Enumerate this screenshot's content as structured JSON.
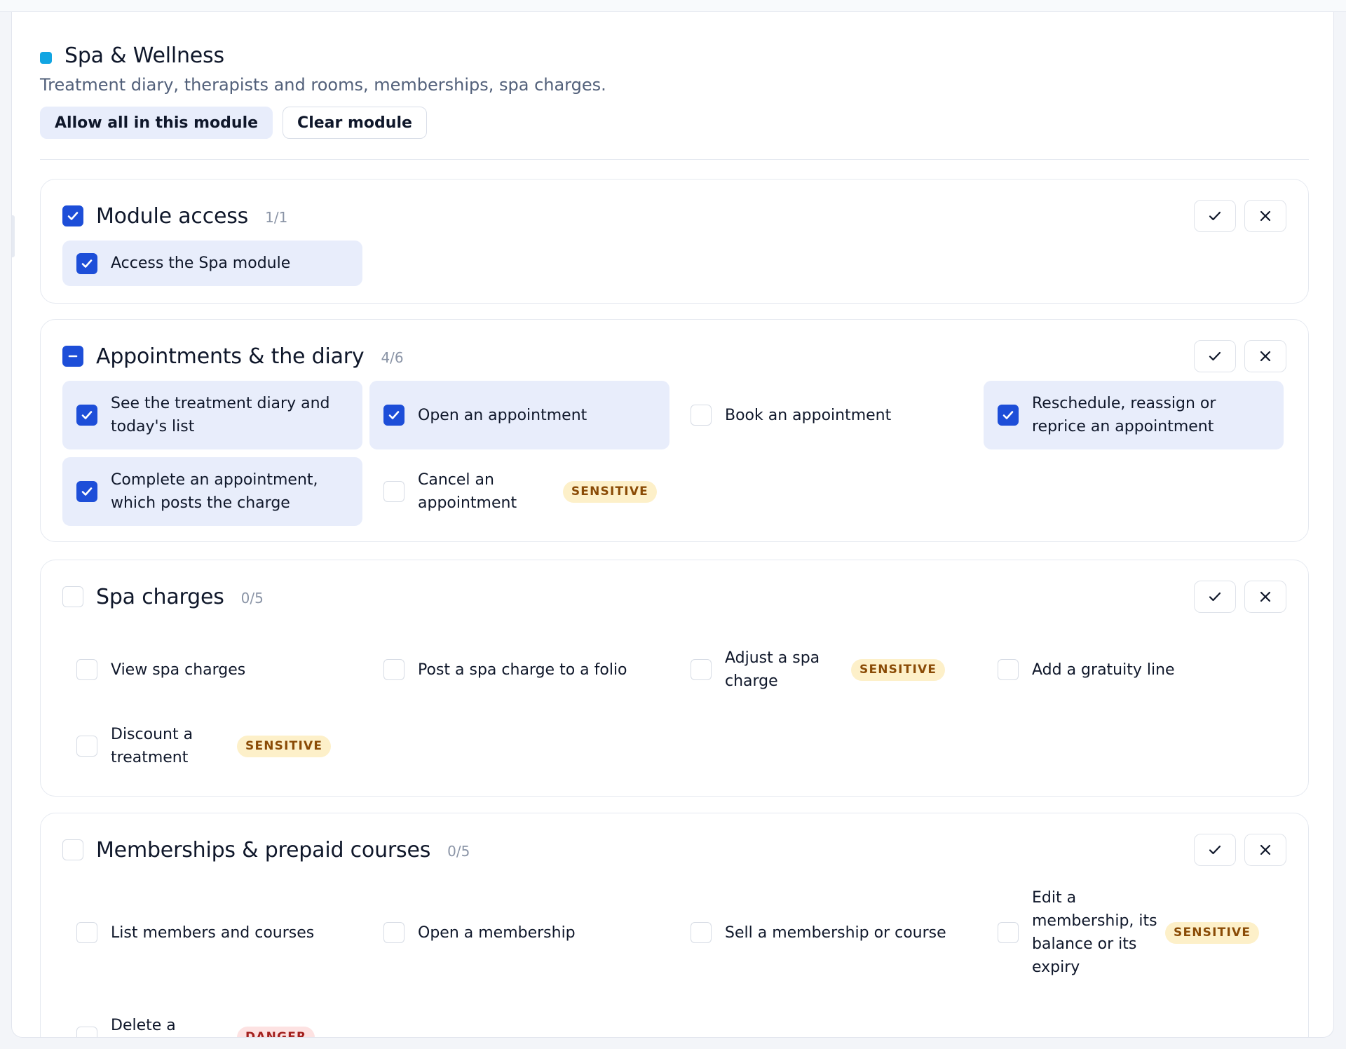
{
  "module": {
    "title": "Spa & Wellness",
    "description": "Treatment diary, therapists and rooms, memberships, spa charges.",
    "allow_all_label": "Allow all in this module",
    "clear_label": "Clear module",
    "accent_color": "#11a5e2"
  },
  "groups": [
    {
      "title": "Module access",
      "count": "1/1",
      "state": "checked",
      "permissions": [
        {
          "label": "Access the Spa module",
          "checked": true,
          "badge": ""
        }
      ]
    },
    {
      "title": "Appointments & the diary",
      "count": "4/6",
      "state": "mixed",
      "permissions": [
        {
          "label": "See the treatment diary and today's list",
          "checked": true,
          "badge": ""
        },
        {
          "label": "Open an appointment",
          "checked": true,
          "badge": ""
        },
        {
          "label": "Book an appointment",
          "checked": false,
          "badge": ""
        },
        {
          "label": "Reschedule, reassign or reprice an appointment",
          "checked": true,
          "badge": ""
        },
        {
          "label": "Complete an appointment, which posts the charge",
          "checked": true,
          "badge": ""
        },
        {
          "label": "Cancel an appointment",
          "checked": false,
          "badge": "SENSITIVE"
        }
      ]
    },
    {
      "title": "Spa charges",
      "count": "0/5",
      "state": "unchecked",
      "permissions": [
        {
          "label": "View spa charges",
          "checked": false,
          "badge": ""
        },
        {
          "label": "Post a spa charge to a folio",
          "checked": false,
          "badge": ""
        },
        {
          "label": "Adjust a spa charge",
          "checked": false,
          "badge": "SENSITIVE"
        },
        {
          "label": "Add a gratuity line",
          "checked": false,
          "badge": ""
        },
        {
          "label": "Discount a treatment",
          "checked": false,
          "badge": "SENSITIVE"
        }
      ]
    },
    {
      "title": "Memberships & prepaid courses",
      "count": "0/5",
      "state": "unchecked",
      "permissions": [
        {
          "label": "List members and courses",
          "checked": false,
          "badge": ""
        },
        {
          "label": "Open a membership",
          "checked": false,
          "badge": ""
        },
        {
          "label": "Sell a membership or course",
          "checked": false,
          "badge": ""
        },
        {
          "label": "Edit a membership, its balance or its expiry",
          "checked": false,
          "badge": "SENSITIVE"
        },
        {
          "label": "Delete a membership",
          "checked": false,
          "badge": "DANGER"
        }
      ]
    }
  ],
  "icons": {
    "check": "check-icon",
    "close": "close-icon",
    "minus": "minus-icon"
  },
  "colors": {
    "checked": "#1d4ed8",
    "selected_row": "#e8edfb",
    "sensitive_bg": "#fdf0c9",
    "danger_bg": "#fde2e2"
  }
}
